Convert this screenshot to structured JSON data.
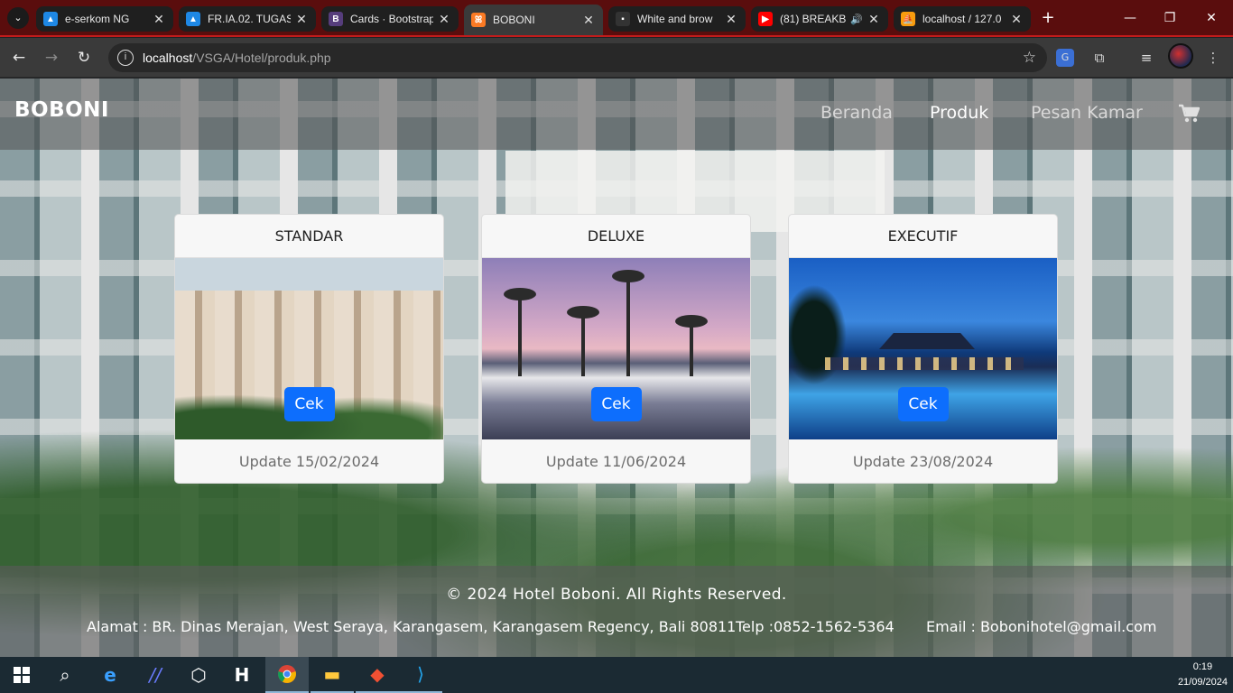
{
  "browser": {
    "tabs": [
      {
        "title": "e-serkom NG",
        "favicon": "triangle-logo",
        "color": "#1e88e5"
      },
      {
        "title": "FR.IA.02. TUGAS",
        "favicon": "triangle-logo",
        "color": "#1e88e5"
      },
      {
        "title": "Cards · Bootstrap",
        "favicon": "bootstrap-b",
        "color": "#563d7c"
      },
      {
        "title": "BOBONI",
        "favicon": "xampp-logo",
        "color": "#fb7a24"
      },
      {
        "title": "White and brow",
        "favicon": "image-thumb",
        "color": "#333333"
      },
      {
        "title": "(81) BREAKB",
        "favicon": "youtube-logo",
        "color": "#ff0000"
      },
      {
        "title": "localhost / 127.0",
        "favicon": "phpmyadmin-logo",
        "color": "#f89c0e"
      }
    ],
    "address": {
      "host": "localhost",
      "path": "/VSGA/Hotel/produk.php"
    }
  },
  "site": {
    "brand": "BOBONI",
    "nav": [
      {
        "label": "Beranda",
        "active": false
      },
      {
        "label": "Produk",
        "active": true
      },
      {
        "label": "Pesan Kamar",
        "active": false
      }
    ],
    "cards": [
      {
        "title": "STANDAR",
        "button": "Cek",
        "update": "Update 15/02/2024"
      },
      {
        "title": "DELUXE",
        "button": "Cek",
        "update": "Update 11/06/2024"
      },
      {
        "title": "EXECUTIF",
        "button": "Cek",
        "update": "Update 23/08/2024"
      }
    ],
    "footer": {
      "copyright": "© 2024 Hotel Boboni. All Rights Reserved.",
      "address": "Alamat : BR. Dinas Merajan, West Seraya, Karangasem, Karangasem Regency, Bali 80811",
      "phone": "Telp :0852-1562-5364",
      "email": "Email : Bobonihotel@gmail.com"
    },
    "accent_color": "#0d6efd"
  },
  "taskbar": {
    "apps": [
      "start-icon",
      "search-icon",
      "edge-icon",
      "vs-icon",
      "unity-icon",
      "heidi-icon",
      "chrome-icon",
      "explorer-icon",
      "git-icon",
      "vscode-icon"
    ],
    "time": "0:19",
    "date": "21/09/2024"
  }
}
